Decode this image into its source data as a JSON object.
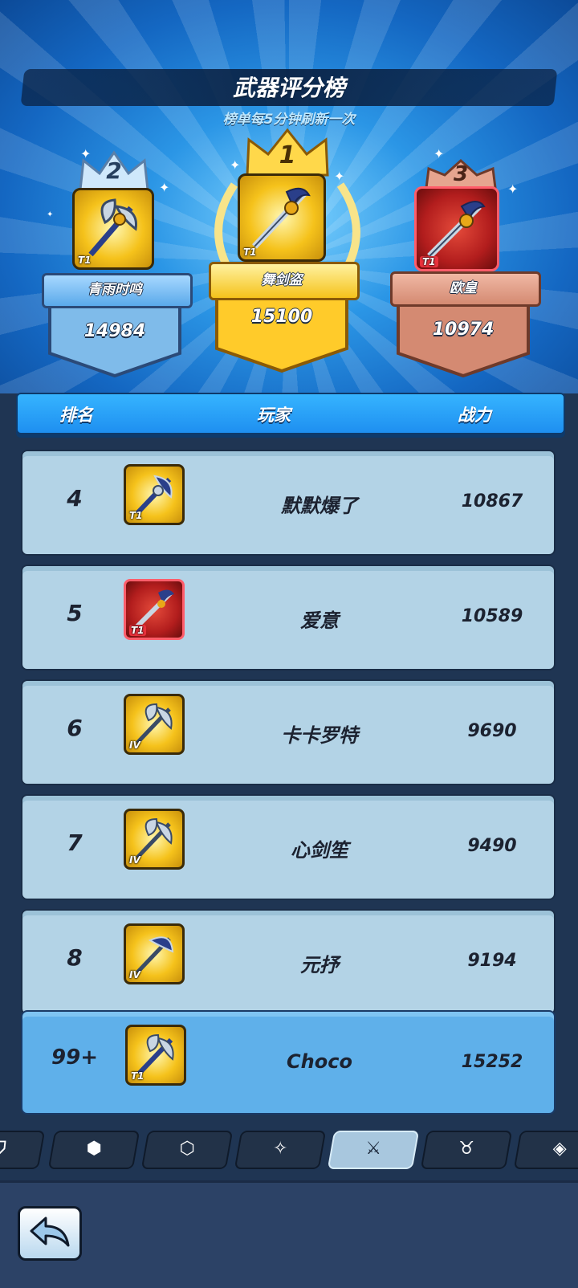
{
  "header": {
    "title": "武器评分榜",
    "subtitle": "榜单每5分钟刷新一次"
  },
  "podium": [
    {
      "rank": "2",
      "name": "青雨时鸣",
      "score": "14984",
      "tier": "T1"
    },
    {
      "rank": "1",
      "name": "舞剑盗",
      "score": "15100",
      "tier": "T1"
    },
    {
      "rank": "3",
      "name": "欧皇",
      "score": "10974",
      "tier": "T1"
    }
  ],
  "columns": {
    "rank": "排名",
    "player": "玩家",
    "power": "战力"
  },
  "rows": [
    {
      "rank": "4",
      "name": "默默爆了",
      "power": "10867",
      "tier": "T1"
    },
    {
      "rank": "5",
      "name": "爱意",
      "power": "10589",
      "tier": "T1"
    },
    {
      "rank": "6",
      "name": "卡卡罗特",
      "power": "9690",
      "tier": "IV"
    },
    {
      "rank": "7",
      "name": "心剑笙",
      "power": "9490",
      "tier": "IV"
    },
    {
      "rank": "8",
      "name": "元抒",
      "power": "9194",
      "tier": "IV"
    }
  ],
  "me": {
    "rank": "99+",
    "name": "Choco",
    "power": "15252",
    "tier": "T1"
  },
  "tabs": [
    {
      "icon": "shield-icon"
    },
    {
      "icon": "pet-icon"
    },
    {
      "icon": "armor-icon"
    },
    {
      "icon": "star-icon"
    },
    {
      "icon": "sword-icon",
      "active": true
    },
    {
      "icon": "horned-helmet-icon"
    },
    {
      "icon": "gem-icon"
    }
  ],
  "colors": {
    "gold": "#f5c21b",
    "red": "#b21d1d",
    "silver": "#7fbbea",
    "bronze": "#d48a72"
  }
}
